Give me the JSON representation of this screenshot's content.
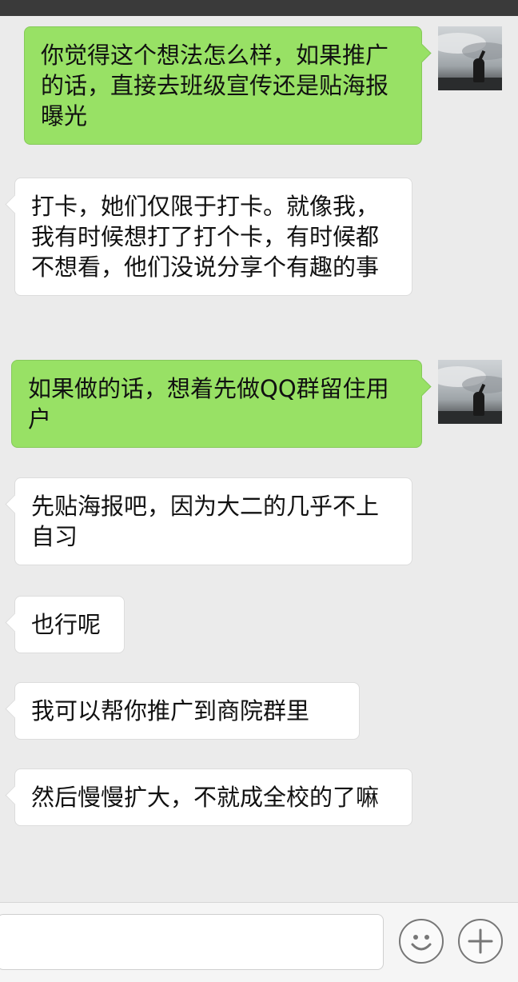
{
  "messages": [
    {
      "side": "out",
      "text": "你觉得这个想法怎么样，如果推广的话，直接去班级宣传还是贴海报曝光"
    },
    {
      "side": "in",
      "text": "打卡，她们仅限于打卡。就像我，我有时候想打了打个卡，有时候都不想看，他们没说分享个有趣的事"
    },
    {
      "side": "out",
      "text": "如果做的话，想着先做QQ群留住用户"
    },
    {
      "side": "in",
      "text": "先贴海报吧，因为大二的几乎不上自习"
    },
    {
      "side": "in",
      "text": "也行呢"
    },
    {
      "side": "in",
      "text": "我可以帮你推广到商院群里"
    },
    {
      "side": "in",
      "text": "然后慢慢扩大，不就成全校的了嘛"
    }
  ],
  "input": {
    "placeholder": ""
  },
  "icons": {
    "emoji": "smiley-face-icon",
    "more": "plus-icon",
    "avatar": "user-avatar"
  },
  "colors": {
    "out_bubble": "#98e165",
    "in_bubble": "#ffffff",
    "background": "#ebebeb"
  }
}
